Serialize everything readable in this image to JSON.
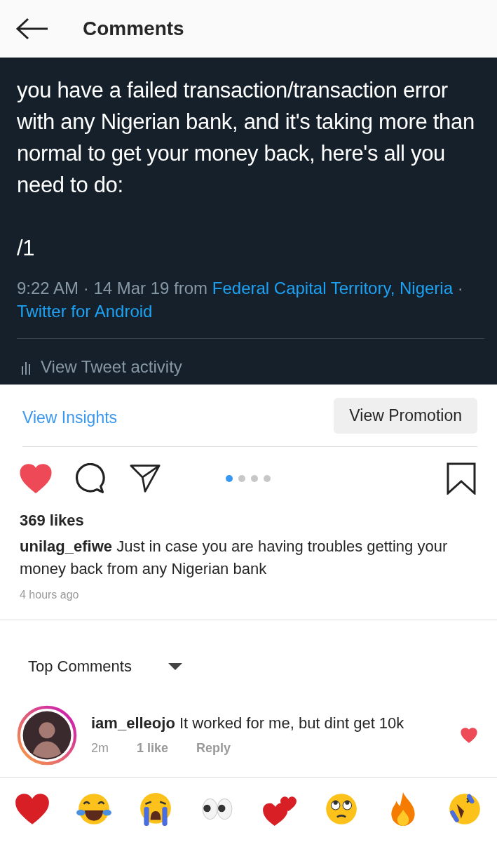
{
  "header": {
    "title": "Comments"
  },
  "tweet": {
    "text": "you have a failed transaction/transaction error with any Nigerian bank, and it's taking more than normal to get your money back, here's all you need to do:",
    "thread_mark": "/1",
    "meta": "9:22 AM · 14 Mar 19 from ",
    "location": "Federal Capital Territory, Nigeria",
    "separator": "· ",
    "client": "Twitter for Android",
    "activity": "View Tweet activity"
  },
  "promo": {
    "insights": "View Insights",
    "promotion": "View Promotion"
  },
  "actions": {
    "liked": true,
    "saved": false,
    "dots": [
      {
        "selected": true
      },
      {
        "selected": false
      },
      {
        "selected": false
      },
      {
        "selected": false
      }
    ]
  },
  "post": {
    "likes": "369 likes",
    "username": "unilag_efiwe",
    "caption": "Just in case you are having troubles getting your money back from any Nigerian bank",
    "time": "4 hours ago"
  },
  "sort": {
    "label": "Top Comments"
  },
  "comments": [
    {
      "username": "iam_elleojo",
      "text": "It worked for me, but dint get 10k",
      "time": "2m",
      "likes": "1 like",
      "reply": "Reply",
      "liked": true
    }
  ]
}
